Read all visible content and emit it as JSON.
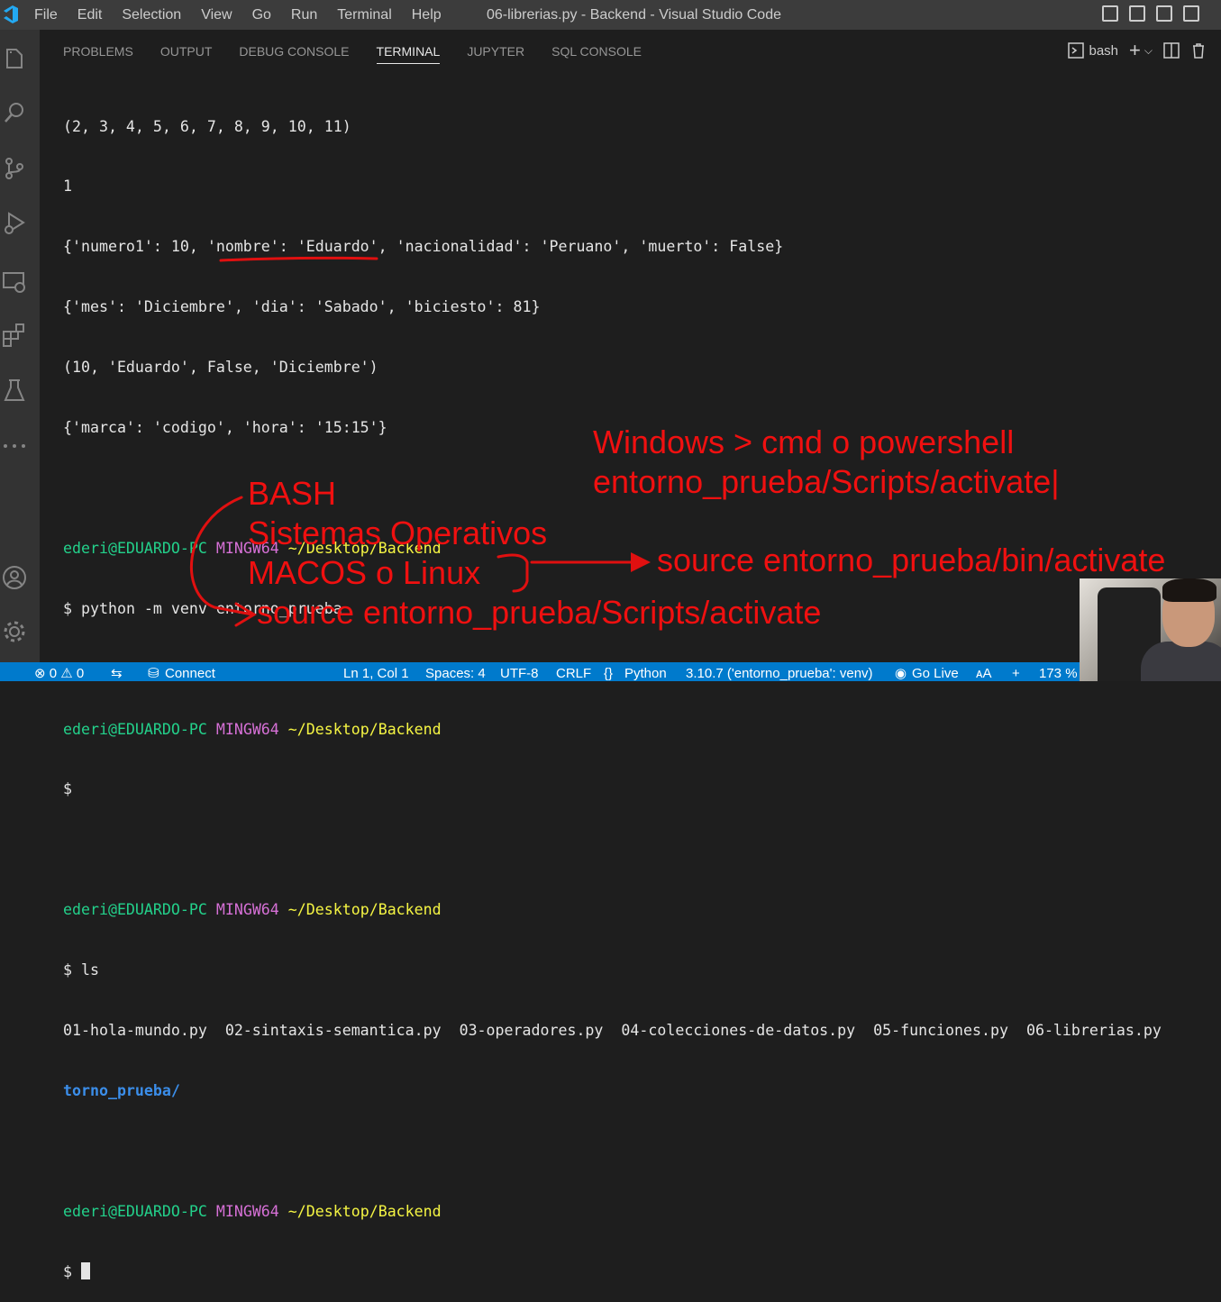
{
  "window": {
    "title": "06-librerias.py - Backend - Visual Studio Code",
    "menu": [
      "File",
      "Edit",
      "Selection",
      "View",
      "Go",
      "Run",
      "Terminal",
      "Help"
    ]
  },
  "panel": {
    "tabs": [
      "PROBLEMS",
      "OUTPUT",
      "DEBUG CONSOLE",
      "TERMINAL",
      "JUPYTER",
      "SQL CONSOLE"
    ],
    "active_tab": "TERMINAL",
    "shell_label": "bash"
  },
  "terminal": {
    "output_lines": [
      "(2, 3, 4, 5, 6, 7, 8, 9, 10, 11)",
      "1",
      "{'numero1': 10, 'nombre': 'Eduardo', 'nacionalidad': 'Peruano', 'muerto': False}",
      "{'mes': 'Diciembre', 'dia': 'Sabado', 'biciesto': 81}",
      "(10, 'Eduardo', False, 'Diciembre')",
      "{'marca': 'codigo', 'hora': '15:15'}"
    ],
    "prompt": {
      "user": "ederi@EDUARDO-PC",
      "host": "MINGW64",
      "path": "~/Desktop/Backend",
      "symbol": "$"
    },
    "cmd1": "python -m venv entorno_prueba",
    "cmd3": "ls",
    "ls_files": "01-hola-mundo.py  02-sintaxis-semantica.py  03-operadores.py  04-colecciones-de-datos.py  05-funciones.py  06-librerias.py",
    "ls_dir": "torno_prueba/"
  },
  "annotations": {
    "windows_line1": "Windows > cmd o powershell",
    "windows_line2": "entorno_prueba/Scripts/activate|",
    "bash": "BASH",
    "so": "Sistemas Operativos",
    "macos": "MACOS o Linux",
    "source_bin": "source entorno_prueba/bin/activate",
    "source_scripts": "source entorno_prueba/Scripts/activate",
    "color": "#f01010"
  },
  "statusbar": {
    "problems": "⊗ 0 ⚠ 0",
    "connect": "Connect",
    "position": "Ln 1, Col 1",
    "spaces": "Spaces: 4",
    "encoding": "UTF-8",
    "eol": "CRLF",
    "language": "Python",
    "interpreter": "3.10.7 ('entorno_prueba': venv)",
    "golive": "Go Live",
    "aa": "ᴀA",
    "plus": "+",
    "zoom": "173 %",
    "color": "#007acc"
  }
}
